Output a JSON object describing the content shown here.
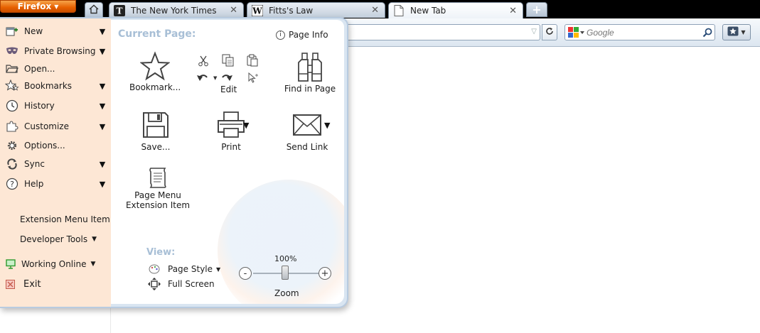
{
  "browser": {
    "app_button_label": "Firefox",
    "tabs": [
      {
        "label": "The New York Times",
        "favicon": "nyt-icon"
      },
      {
        "label": "Fitts's Law",
        "favicon": "wikipedia-icon"
      },
      {
        "label": "New Tab",
        "favicon": "page-icon",
        "active": true
      }
    ],
    "new_tab_label": "+",
    "search_placeholder": "Google",
    "accent_color": "#e66000"
  },
  "menu": {
    "left_items": [
      {
        "label": "New",
        "icon": "new-window-icon",
        "has_submenu": true
      },
      {
        "label": "Private Browsing",
        "icon": "private-mask-icon",
        "has_submenu": true
      },
      {
        "label": "Open...",
        "icon": "folder-icon",
        "has_submenu": false
      },
      {
        "label": "Bookmarks",
        "icon": "stars-icon",
        "has_submenu": true
      },
      {
        "label": "History",
        "icon": "clock-icon",
        "has_submenu": true
      },
      {
        "label": "Customize",
        "icon": "puzzle-icon",
        "has_submenu": true
      },
      {
        "label": "Options...",
        "icon": "gear-icon",
        "has_submenu": false
      },
      {
        "label": "Sync",
        "icon": "sync-icon",
        "has_submenu": true
      },
      {
        "label": "Help",
        "icon": "help-icon",
        "has_submenu": true
      }
    ],
    "extension_item": "Extension Menu Item",
    "developer_tools": "Developer Tools",
    "working_online": "Working Online",
    "exit": "Exit",
    "current_page_title": "Current Page:",
    "page_info": "Page Info",
    "commands": {
      "bookmark": "Bookmark...",
      "edit": "Edit",
      "find": "Find in Page",
      "save": "Save...",
      "print": "Print",
      "send_link": "Send Link",
      "page_menu_ext_line1": "Page Menu",
      "page_menu_ext_line2": "Extension Item"
    },
    "view_title": "View:",
    "page_style": "Page Style",
    "full_screen": "Full Screen",
    "zoom_percent": "100%",
    "zoom_label": "Zoom",
    "zoom_minus": "-",
    "zoom_plus": "+",
    "zoom_level": 1.0
  }
}
